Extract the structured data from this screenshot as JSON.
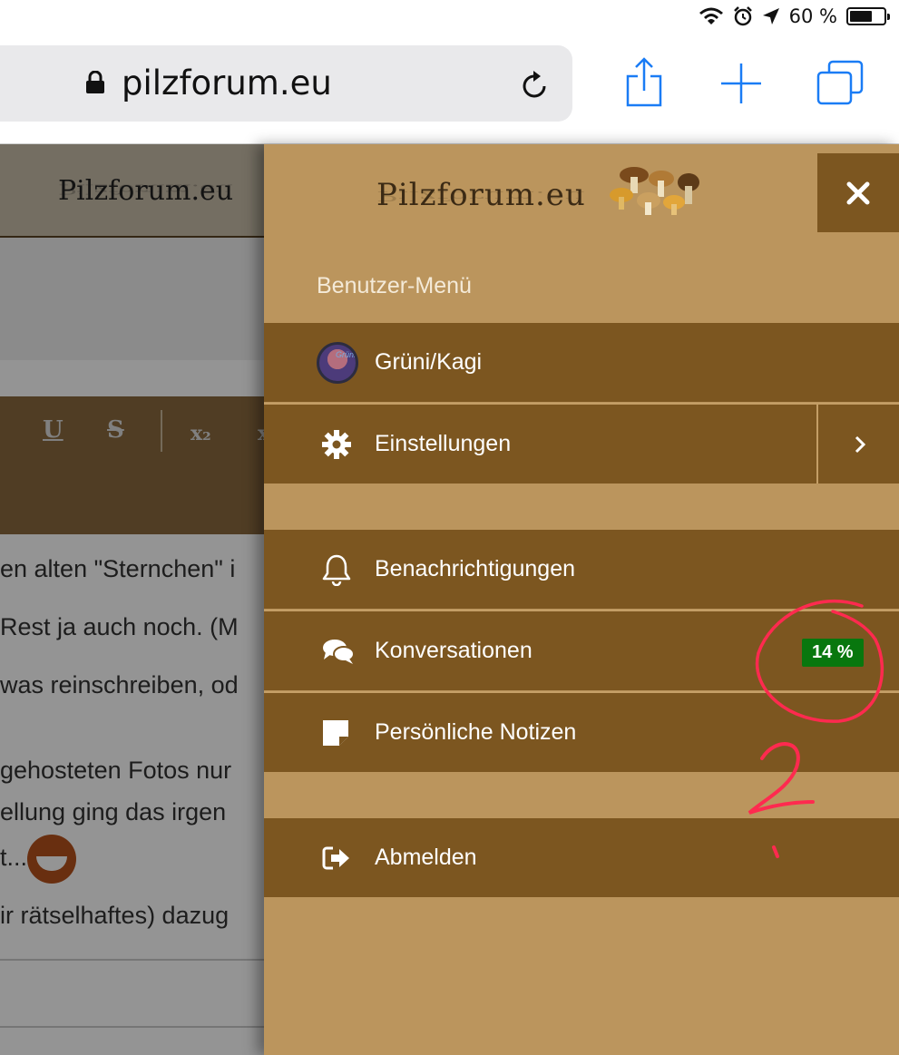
{
  "status_bar": {
    "battery_text": "60 %",
    "battery_level": 0.6
  },
  "browser": {
    "url": "pilzforum.eu"
  },
  "page": {
    "logo": "Pilzforum.eu",
    "editor_buttons": [
      "U",
      "S",
      "x₂",
      "x"
    ],
    "text_lines": [
      "en alten \"Sternchen\" i",
      "Rest ja auch noch. (M",
      "was reinschreiben, od",
      "gehosteten Fotos nur",
      "ellung ging das irgen",
      "t...",
      "ir rätselhaftes) dazug"
    ]
  },
  "menu": {
    "logo": "Pilzforum.eu",
    "heading": "Benutzer-Menü",
    "items": [
      {
        "label": "Grüni/Kagi",
        "icon": "user-avatar"
      },
      {
        "label": "Einstellungen",
        "icon": "gear-icon"
      },
      {
        "label": "Benachrichtigungen",
        "icon": "bell-icon"
      },
      {
        "label": "Konversationen",
        "icon": "chat-bubbles-icon",
        "badge": "14 %"
      },
      {
        "label": "Persönliche Notizen",
        "icon": "note-icon"
      },
      {
        "label": "Abmelden",
        "icon": "sign-out-icon"
      }
    ]
  },
  "colors": {
    "menu_bg": "#bb955d",
    "item_bg": "#7c5620",
    "badge_bg": "#08770e",
    "annotation": "#ff2a4f",
    "ios_blue": "#1a7cf5"
  },
  "annotation": {
    "text": "2"
  }
}
